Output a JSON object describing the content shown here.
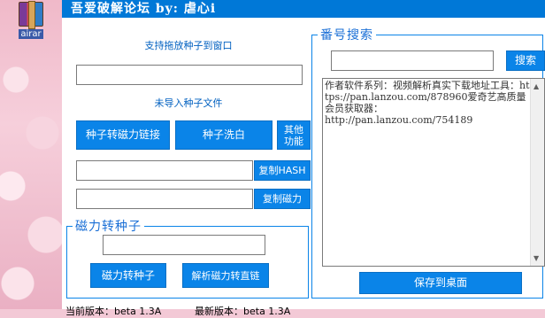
{
  "desktop": {
    "icon_label": "airar"
  },
  "window": {
    "title": "吾爱破解论坛 by: 虐心i"
  },
  "left": {
    "drag_label": "支持拖放种子到窗口",
    "drop_value": "",
    "status_label": "未导入种子文件",
    "to_magnet_button": "种子转磁力链接",
    "clean_button": "种子洗白",
    "other_button": "其他功能",
    "hash_value": "",
    "copy_hash_button": "复制HASH",
    "magnet_value": "",
    "copy_magnet_button": "复制磁力"
  },
  "magnet_group": {
    "legend": "磁力转种子",
    "input_value": "",
    "to_torrent_button": "磁力转种子",
    "parse_button": "解析磁力转直链"
  },
  "search_group": {
    "legend": "番号搜索",
    "input_value": "",
    "search_button": "搜索",
    "textarea": "作者软件系列：视频解析真实下载地址工具：https://pan.lanzou.com/878960爱奇艺高质量会员获取器：\nhttp://pan.lanzou.com/754189",
    "save_button": "保存到桌面"
  },
  "statusbar": {
    "current_version": "当前版本：beta 1.3A",
    "latest_version": "最新版本：beta 1.3A"
  }
}
